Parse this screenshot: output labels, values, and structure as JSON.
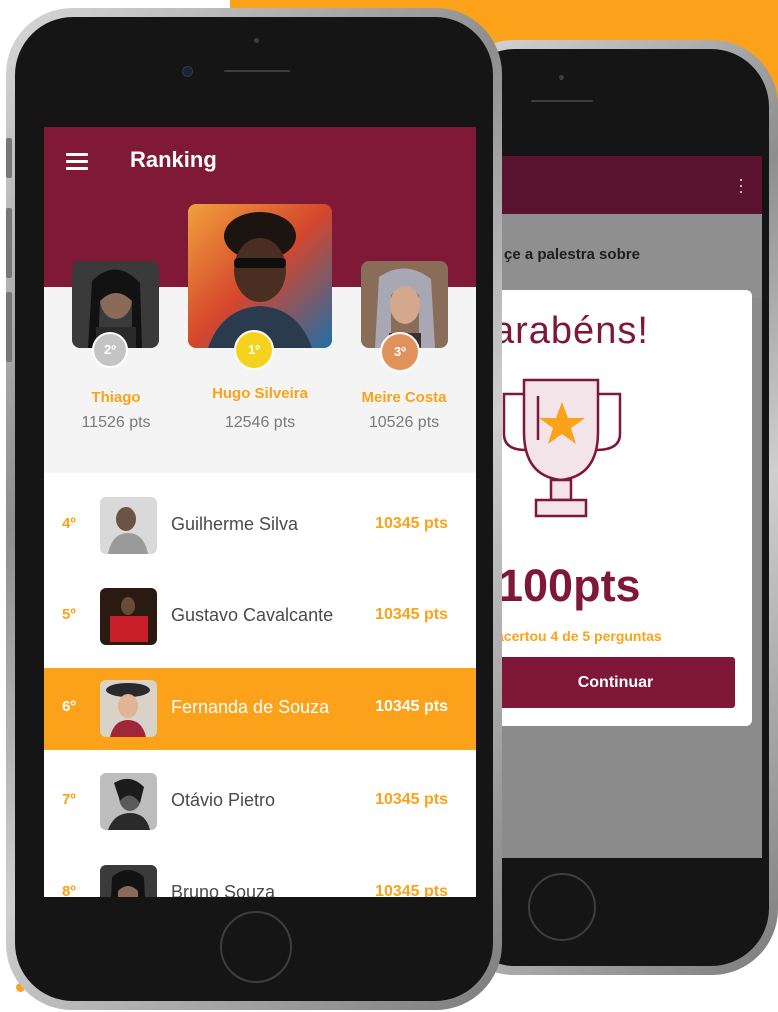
{
  "colors": {
    "accent": "#FBA21A",
    "brand": "#801838",
    "brand_dark": "#5a1430"
  },
  "ranking_screen": {
    "title": "Ranking",
    "menu_icon": "hamburger-menu-icon",
    "podium": [
      {
        "rank": "2º",
        "name": "Thiago",
        "points": "11526 pts",
        "badge_color": "#c4c4c4"
      },
      {
        "rank": "1º",
        "name": "Hugo Silveira",
        "points": "12546 pts",
        "badge_color": "#F5D21E"
      },
      {
        "rank": "3º",
        "name": "Meire Costa",
        "points": "10526 pts",
        "badge_color": "#E0925A"
      }
    ],
    "list": [
      {
        "rank": "4º",
        "name": "Guilherme Silva",
        "points": "10345 pts"
      },
      {
        "rank": "5º",
        "name": "Gustavo Cavalcante",
        "points": "10345 pts"
      },
      {
        "rank": "6º",
        "name": "Fernanda de Souza",
        "points": "10345 pts",
        "highlighted": true
      },
      {
        "rank": "7º",
        "name": "Otávio Pietro",
        "points": "10345 pts"
      },
      {
        "rank": "8º",
        "name": "Bruno Souza",
        "points": "10345 pts"
      }
    ]
  },
  "result_screen": {
    "menu_icon": "more-vert-icon",
    "subtitle": "ҫe a palestra sobre",
    "dialog": {
      "title": "arabéns!",
      "trophy_icon": "trophy-star-icon",
      "points": "100pts",
      "summary": "acertou 4 de 5 perguntas",
      "button_label": "Continuar"
    }
  }
}
